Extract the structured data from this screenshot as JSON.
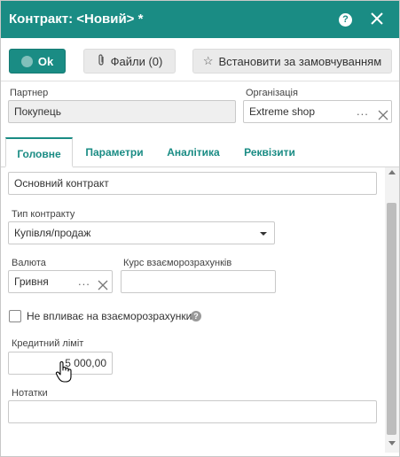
{
  "window": {
    "title": "Контракт: <Новий> *"
  },
  "toolbar": {
    "ok_label": "Ok",
    "files_label": "Файли (0)",
    "set_default_label": "Встановити за замовчуванням"
  },
  "header_fields": {
    "partner": {
      "label": "Партнер",
      "value": "Покупець"
    },
    "organization": {
      "label": "Організація",
      "value": "Extreme shop",
      "dots": "..."
    }
  },
  "tabs": [
    {
      "label": "Головне",
      "active": true
    },
    {
      "label": "Параметри",
      "active": false
    },
    {
      "label": "Аналітика",
      "active": false
    },
    {
      "label": "Реквізити",
      "active": false
    }
  ],
  "main": {
    "name_value": "Основний контракт",
    "contract_type": {
      "label": "Тип контракту",
      "value": "Купівля/продаж"
    },
    "currency": {
      "label": "Валюта",
      "value": "Гривня",
      "dots": "..."
    },
    "exchange_rate": {
      "label": "Курс взаєморозрахунків",
      "value": ""
    },
    "no_effect_checkbox": {
      "label": "Не впливає на взаєморозрахунки",
      "checked": false
    },
    "credit_limit": {
      "label": "Кредитний ліміт",
      "value": "5 000,00"
    },
    "notes": {
      "label": "Нотатки",
      "value": ""
    }
  },
  "colors": {
    "accent": "#1a8c84"
  },
  "icons": {
    "help": "help-icon",
    "close": "close-icon",
    "ok": "check-circle-icon",
    "files": "paperclip-icon",
    "default": "star-icon"
  }
}
